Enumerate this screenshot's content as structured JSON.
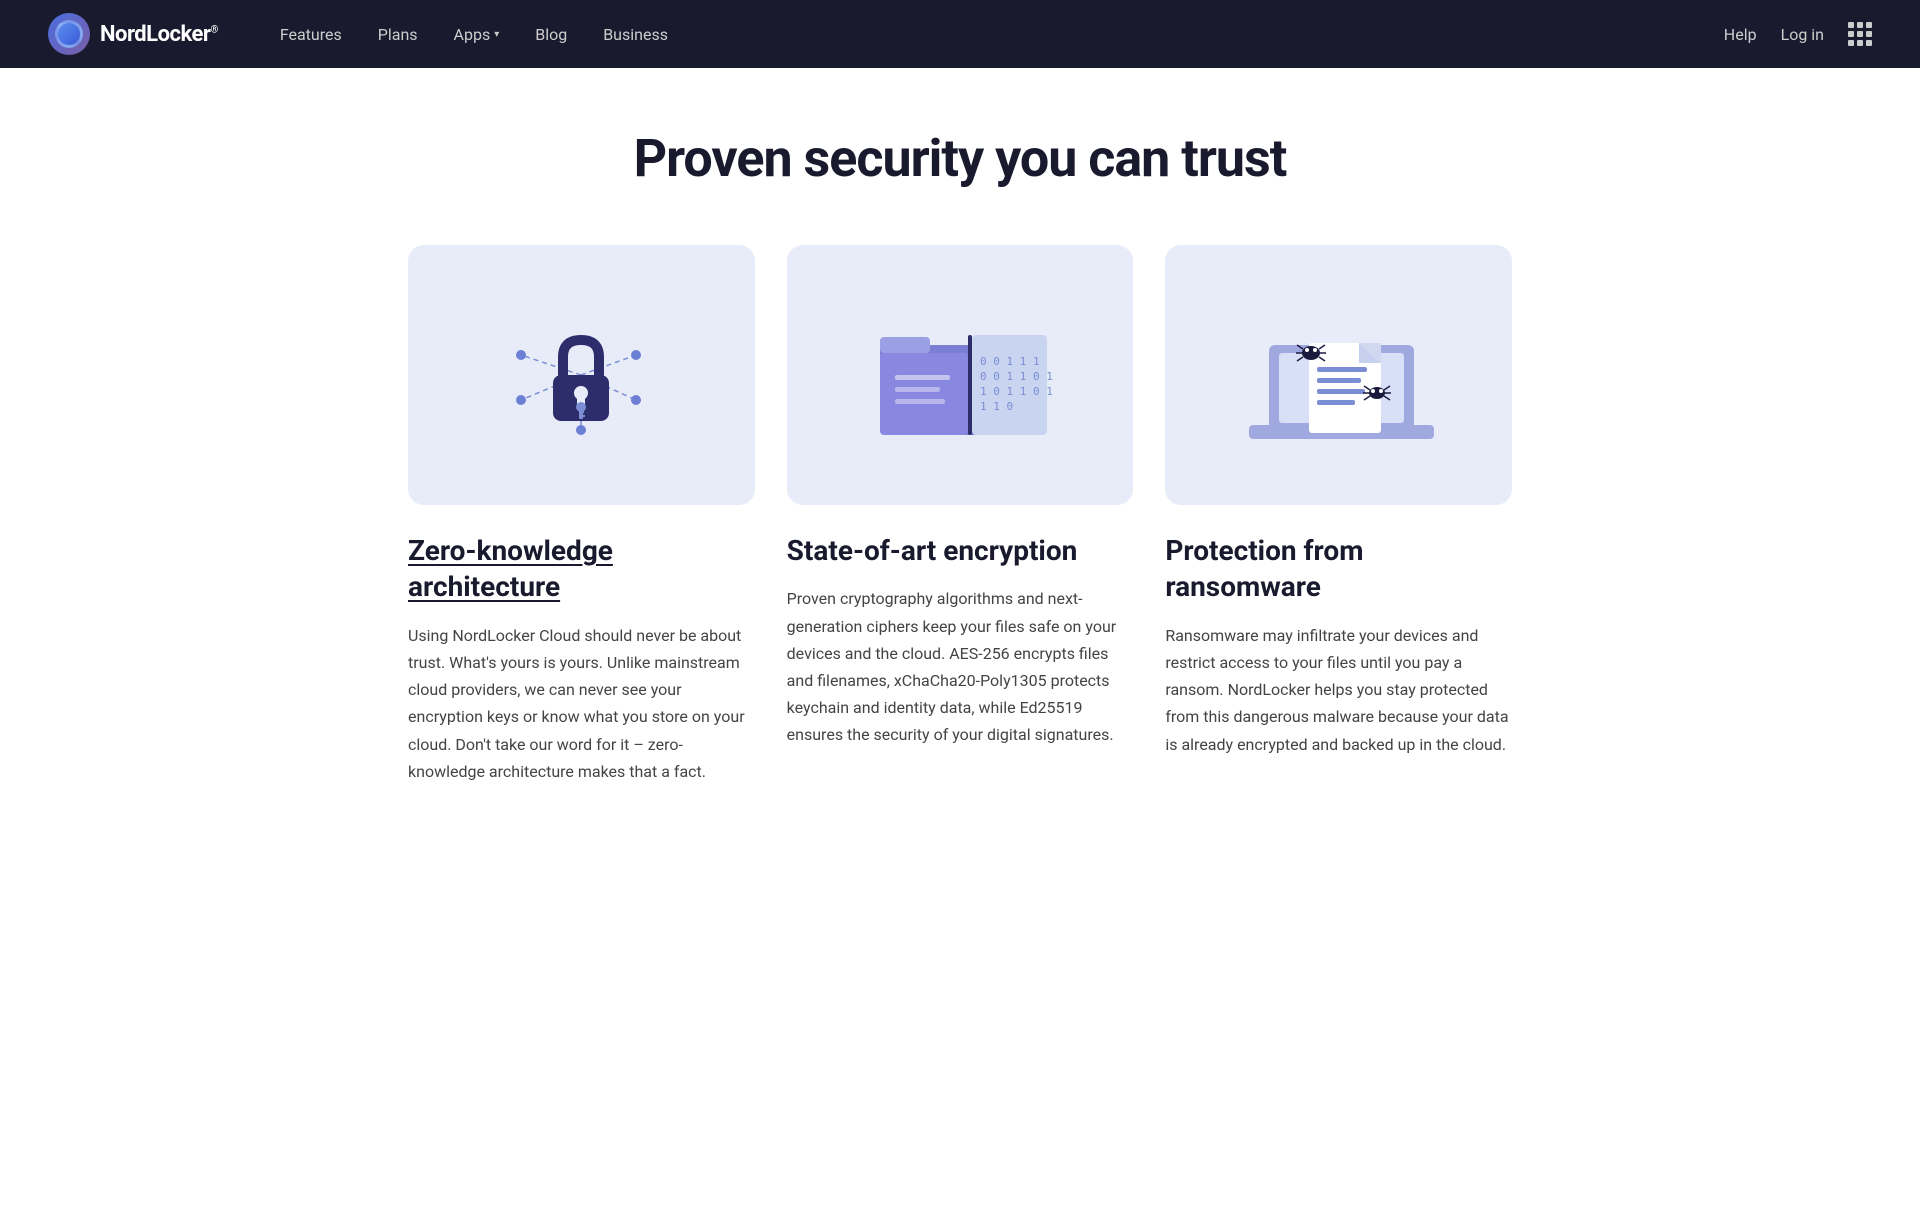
{
  "nav": {
    "brand": "NordLocker",
    "brand_sup": "®",
    "links": [
      {
        "label": "Features",
        "has_dropdown": false
      },
      {
        "label": "Plans",
        "has_dropdown": false
      },
      {
        "label": "Apps",
        "has_dropdown": true
      },
      {
        "label": "Blog",
        "has_dropdown": false
      },
      {
        "label": "Business",
        "has_dropdown": false
      }
    ],
    "right_links": [
      {
        "label": "Help"
      },
      {
        "label": "Log in"
      }
    ]
  },
  "page": {
    "title": "Proven security you can trust"
  },
  "features": [
    {
      "title": "Zero-knowledge architecture",
      "underlined": true,
      "description": "Using NordLocker Cloud should never be about trust. What's yours is yours. Unlike mainstream cloud providers, we can never see your encryption keys or know what you store on your cloud. Don't take our word for it – zero-knowledge architecture makes that a fact.",
      "illustration": "lock"
    },
    {
      "title": "State-of-art encryption",
      "underlined": false,
      "description": "Proven cryptography algorithms and next-generation ciphers keep your files safe on your devices and the cloud. AES-256 encrypts files and filenames, xChaCha20-Poly1305 protects keychain and identity data, while Ed25519 ensures the security of your digital signatures.",
      "illustration": "folder"
    },
    {
      "title": "Protection from ransomware",
      "underlined": false,
      "description": "Ransomware may infiltrate your devices and restrict access to your files until you pay a ransom. NordLocker helps you stay protected from this dangerous malware because your data is already encrypted and backed up in the cloud.",
      "illustration": "laptop"
    }
  ]
}
